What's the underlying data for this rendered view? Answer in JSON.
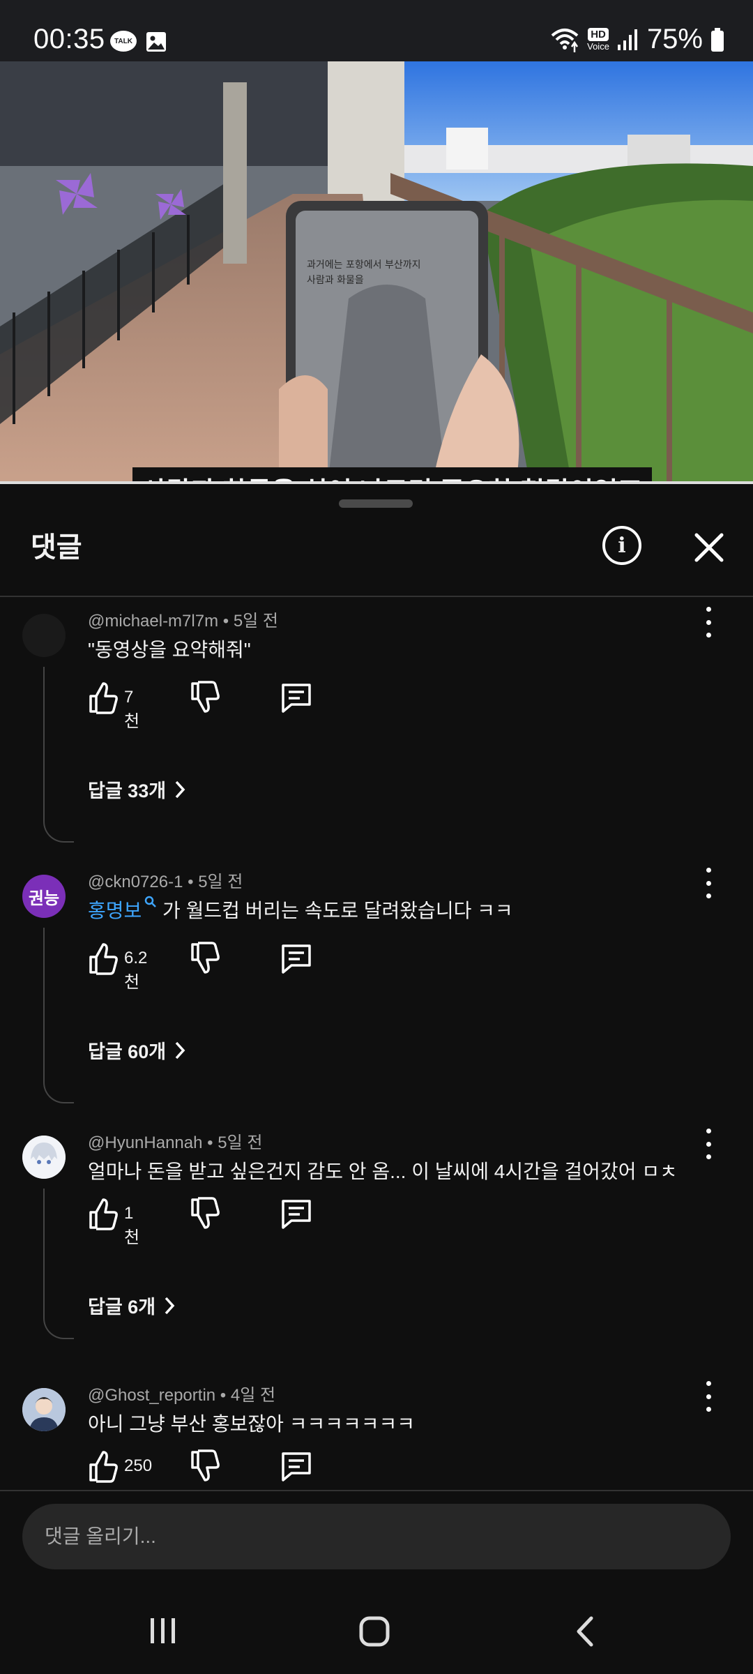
{
  "status_bar": {
    "time": "00:35",
    "talk_badge": "TALK",
    "hd_badge": "HD",
    "voice_label": "Voice",
    "battery": "75%"
  },
  "video": {
    "subtitle": "사람과 화물을 실어 나르던 중요한 철길이었죠",
    "phone_screen_text": "과거에는 포항에서 부산까지\n사람과 화물을"
  },
  "sheet": {
    "title": "댓글",
    "input_placeholder": "댓글 올리기..."
  },
  "comments": [
    {
      "author": "@michael-m7l7m",
      "time": "5일 전",
      "text": "\"동영상을 요약해줘\"",
      "likes": "7천",
      "replies": "답글 33개",
      "avatar_text": ""
    },
    {
      "author": "@ckn0726-1",
      "time": "5일 전",
      "mention": "홍명보",
      "text": " 가 월드컵 버리는 속도로 달려왔습니다 ㅋㅋ",
      "likes": "6.2천",
      "replies": "답글 60개",
      "avatar_text": "권능",
      "avatar_color": "#7b2fb8"
    },
    {
      "author": "@HyunHannah",
      "time": "5일 전",
      "text": "얼마나 돈을 받고 싶은건지 감도 안 옴... 이 날씨에 4시간을 걸어갔어 ㅁㅊ",
      "likes": "1천",
      "replies": "답글 6개",
      "avatar_text": ""
    },
    {
      "author": "@Ghost_reportin",
      "time": "4일 전",
      "text": "아니 그냥 부산 홍보잖아 ㅋㅋㅋㅋㅋㅋㅋ",
      "likes": "250",
      "avatar_text": ""
    }
  ],
  "icons": [
    "talk-icon",
    "gallery-icon",
    "wifi-icon",
    "signal-icon",
    "battery-icon",
    "info-icon",
    "close-icon",
    "like-icon",
    "dislike-icon",
    "reply-icon",
    "more-icon",
    "chevron-right-icon",
    "recents-icon",
    "home-icon",
    "back-icon",
    "search-icon"
  ]
}
